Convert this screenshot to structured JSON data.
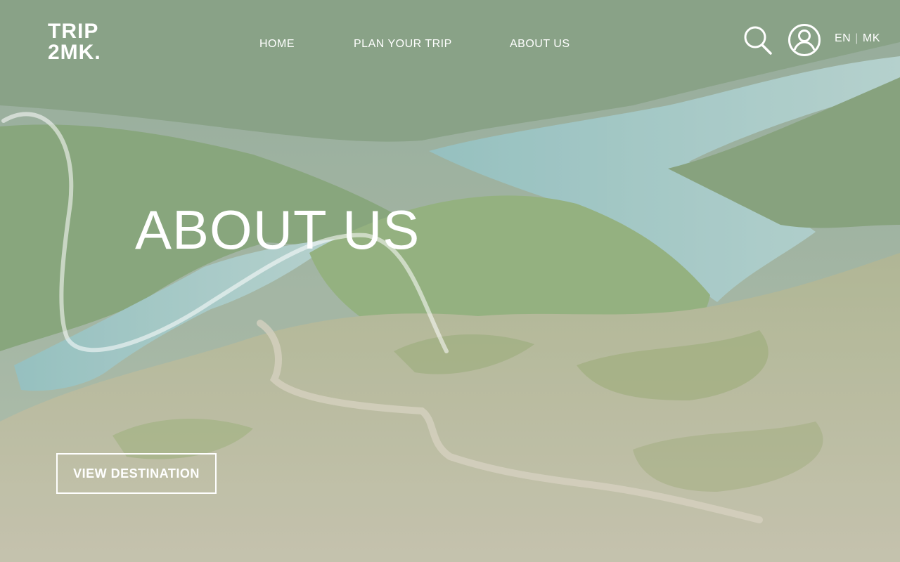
{
  "brand": {
    "logo_line1": "TRIP",
    "logo_line2": "2MK."
  },
  "nav": {
    "home": "HOME",
    "plan": "PLAN YOUR TRIP",
    "about": "ABOUT US"
  },
  "header": {
    "icons": {
      "search": "search-icon",
      "user": "user-icon"
    },
    "lang": {
      "current": "EN",
      "separator": "|",
      "other": "MK"
    }
  },
  "hero": {
    "title": "ABOUT US",
    "cta_label": "VIEW DESTINATION",
    "background": "mountain-valley-reservoir-photo"
  },
  "colors": {
    "text": "#ffffff"
  }
}
